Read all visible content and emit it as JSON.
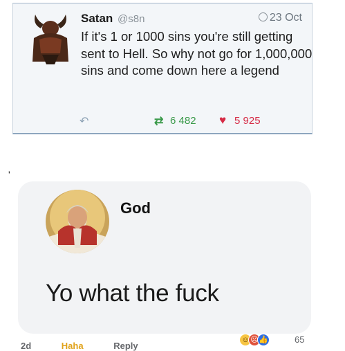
{
  "tweet": {
    "name": "Satan",
    "handle": "@s8n",
    "date": "23 Oct",
    "text": "If it's 1 or 1000 sins you're still getting sent to Hell. So why not go for 1,000,000 sins and come down here a legend",
    "retweets": "6 482",
    "likes": "5 925",
    "icons": {
      "reply": "reply-icon",
      "retweet": "retweet-icon",
      "like": "heart-icon",
      "date": "clock-icon"
    },
    "colors": {
      "retweet": "#3a9a4a",
      "like": "#d62a45"
    }
  },
  "stray_mark": "'",
  "comment": {
    "author": "God",
    "text": "Yo what the fuck",
    "reaction_count": "65",
    "reactions": [
      "haha-icon",
      "angry-icon",
      "like-icon"
    ]
  },
  "comment_actions": {
    "time": "2d",
    "haha": "Haha",
    "reply": "Reply"
  }
}
